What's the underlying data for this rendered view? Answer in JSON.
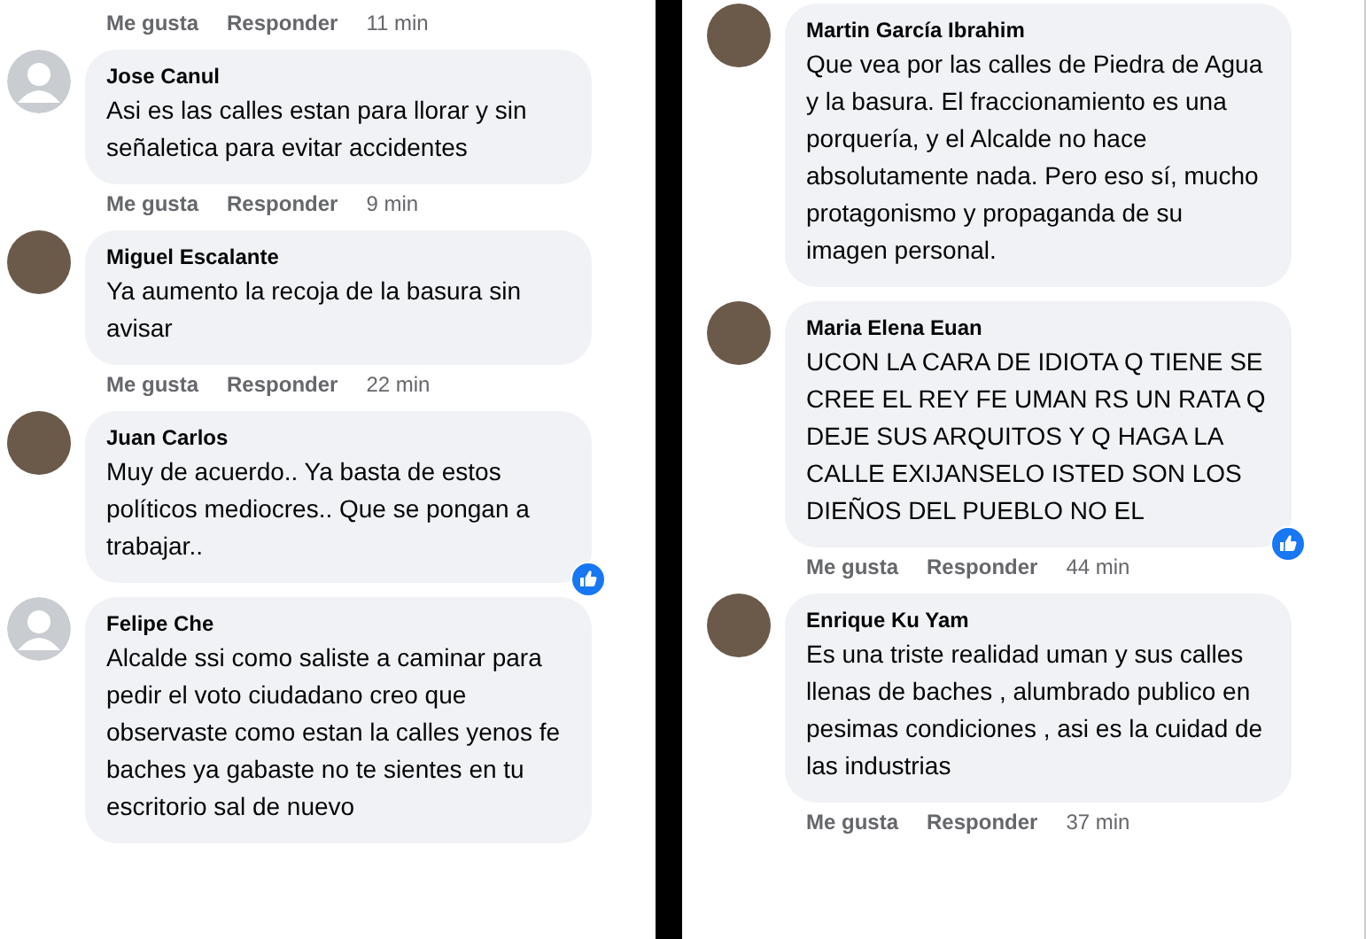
{
  "left_panel": {
    "top_actions": {
      "like": "Me gusta",
      "reply": "Responder",
      "time": "11 min"
    },
    "comments": [
      {
        "author": "Jose Canul",
        "avatar": {
          "kind": "default"
        },
        "text": "Asi es las calles estan para llorar y sin señaletica para evitar accidentes",
        "reacted": false,
        "actions": {
          "like": "Me gusta",
          "reply": "Responder",
          "time": "9 min"
        }
      },
      {
        "author": "Miguel Escalante",
        "avatar": {
          "kind": "photo"
        },
        "text": "Ya aumento la recoja de la basura sin avisar",
        "reacted": false,
        "actions": {
          "like": "Me gusta",
          "reply": "Responder",
          "time": "22 min"
        }
      },
      {
        "author": "Juan Carlos",
        "avatar": {
          "kind": "photo"
        },
        "text": "Muy de acuerdo.. Ya basta de estos políticos mediocres.. Que se pongan a trabajar..",
        "reacted": true
      },
      {
        "author": "Felipe Che",
        "avatar": {
          "kind": "default"
        },
        "text": "Alcalde ssi como saliste a caminar para pedir el voto ciudadano creo que observaste como estan la calles yenos fe baches ya gabaste no te sientes en tu escritorio sal de nuevo",
        "reacted": false
      }
    ]
  },
  "right_panel": {
    "comments": [
      {
        "author": "Martin García Ibrahim",
        "avatar": {
          "kind": "photo"
        },
        "text": "Que vea por las calles de Piedra de Agua y la basura. El fraccionamiento es una porquería, y el Alcalde no hace absolutamente nada. Pero eso sí, mucho protagonismo y propaganda de su imagen personal.",
        "reacted": false
      },
      {
        "author": "Maria Elena Euan",
        "avatar": {
          "kind": "photo"
        },
        "text": "UCON LA CARA DE IDIOTA Q TIENE SE CREE EL REY FE UMAN RS UN RATA Q DEJE SUS ARQUITOS Y Q HAGA LA CALLE EXIJANSELO ISTED SON LOS DIEÑOS DEL PUEBLO NO EL",
        "reacted": true,
        "actions": {
          "like": "Me gusta",
          "reply": "Responder",
          "time": "44 min"
        }
      },
      {
        "author": "Enrique Ku Yam",
        "avatar": {
          "kind": "photo"
        },
        "text": "Es una triste realidad uman y sus calles llenas de baches , alumbrado publico en pesimas condiciones , asi es la cuidad de las industrias",
        "reacted": false,
        "actions": {
          "like": "Me gusta",
          "reply": "Responder",
          "time": "37 min"
        }
      }
    ]
  }
}
